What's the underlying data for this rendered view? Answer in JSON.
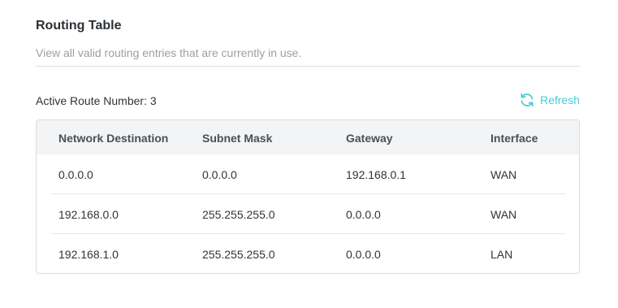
{
  "section": {
    "title": "Routing Table",
    "description": "View all valid routing entries that are currently in use."
  },
  "route_count_label": "Active Route Number: 3",
  "refresh": {
    "label": "Refresh",
    "icon": "refresh-icon",
    "color": "#4acbd6"
  },
  "table": {
    "headers": [
      "Network Destination",
      "Subnet Mask",
      "Gateway",
      "Interface"
    ],
    "rows": [
      [
        "0.0.0.0",
        "0.0.0.0",
        "192.168.0.1",
        "WAN"
      ],
      [
        "192.168.0.0",
        "255.255.255.0",
        "0.0.0.0",
        "WAN"
      ],
      [
        "192.168.1.0",
        "255.255.255.0",
        "0.0.0.0",
        "LAN"
      ]
    ]
  }
}
